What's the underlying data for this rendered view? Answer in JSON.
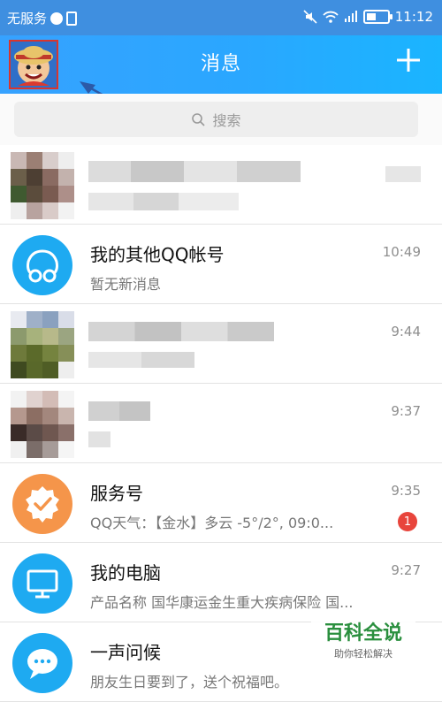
{
  "status": {
    "carrier": "无服务",
    "time": "11:12"
  },
  "header": {
    "title": "消息"
  },
  "search": {
    "placeholder": "搜索"
  },
  "conversations": [
    {
      "name": "",
      "preview": "",
      "time": "",
      "blurred": true
    },
    {
      "name": "我的其他QQ帐号",
      "preview": "暂无新消息",
      "time": "10:49",
      "icon": "qq-account-icon",
      "icon_color": "#1eaaf1"
    },
    {
      "name": "",
      "preview": "",
      "time": "9:44",
      "blurred": true
    },
    {
      "name": "",
      "preview": "",
      "time": "9:37",
      "blurred": true
    },
    {
      "name": "服务号",
      "preview": "QQ天气：【金水】多云 -5°/2°, 09:0...",
      "time": "9:35",
      "badge": "1",
      "icon": "service-badge-icon",
      "icon_color": "#f5954a"
    },
    {
      "name": "我的电脑",
      "preview": "产品名称 国华康运金生重大疾病保险 国...",
      "time": "9:27",
      "icon": "monitor-icon",
      "icon_color": "#1eaaf1"
    },
    {
      "name": "一声问候",
      "preview": "朋友生日要到了，送个祝福吧。",
      "time": "",
      "icon": "chat-bubble-icon",
      "icon_color": "#1eaaf1"
    }
  ],
  "watermark": {
    "main": "百科全说",
    "sub": "助你轻松解决"
  }
}
